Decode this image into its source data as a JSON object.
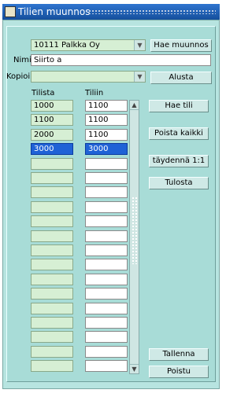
{
  "window": {
    "title": "Tilien muunnos"
  },
  "company": {
    "value": "10111 Palkka Oy",
    "button": "Hae muunnos"
  },
  "name": {
    "label": "Nimi",
    "value": "Siirto a"
  },
  "copy": {
    "label": "Kopioi",
    "value": "",
    "button": "Alusta"
  },
  "columns": {
    "from": "Tilista",
    "to": "Tiliin"
  },
  "rows": [
    {
      "from": "1000",
      "to": "1100"
    },
    {
      "from": "1100",
      "to": "1100"
    },
    {
      "from": "2000",
      "to": "1100"
    },
    {
      "from": "3000",
      "to": "3000"
    },
    {
      "from": "",
      "to": ""
    },
    {
      "from": "",
      "to": ""
    },
    {
      "from": "",
      "to": ""
    },
    {
      "from": "",
      "to": ""
    },
    {
      "from": "",
      "to": ""
    },
    {
      "from": "",
      "to": ""
    },
    {
      "from": "",
      "to": ""
    },
    {
      "from": "",
      "to": ""
    },
    {
      "from": "",
      "to": ""
    },
    {
      "from": "",
      "to": ""
    },
    {
      "from": "",
      "to": ""
    },
    {
      "from": "",
      "to": ""
    },
    {
      "from": "",
      "to": ""
    },
    {
      "from": "",
      "to": ""
    },
    {
      "from": "",
      "to": ""
    }
  ],
  "selected_row": 3,
  "buttons": {
    "hae_tili": "Hae tili",
    "poista_kaikki": "Poista kaikki",
    "taydenna": "täydennä 1:1",
    "tulosta": "Tulosta",
    "tallenna": "Tallenna",
    "poistu": "Poistu"
  },
  "icons": {
    "window": "app-icon",
    "dropdown": "chevron-down-icon",
    "scroll_up": "arrow-up-icon",
    "scroll_down": "arrow-down-icon"
  }
}
